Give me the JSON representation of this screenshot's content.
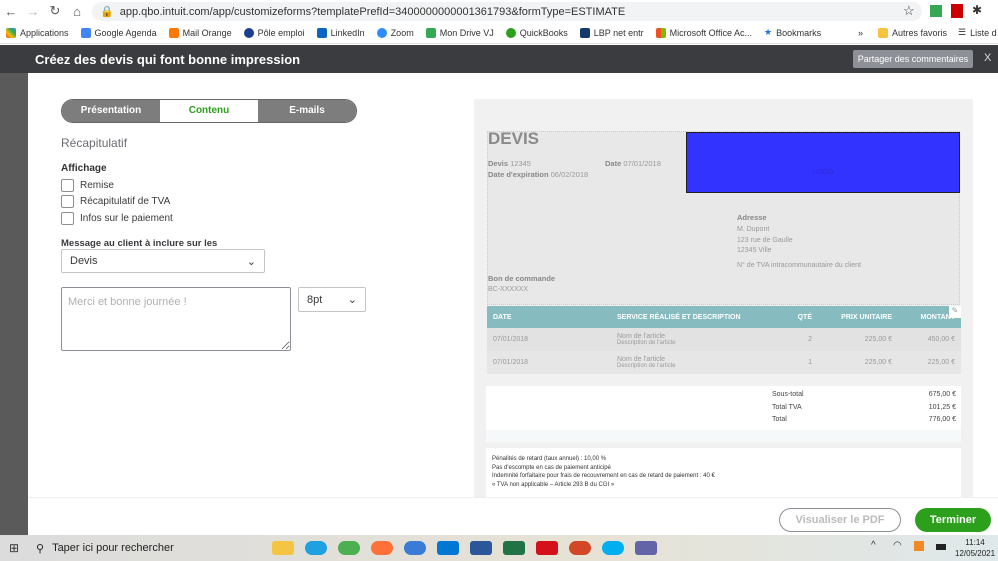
{
  "browser": {
    "url": "app.qbo.intuit.com/app/customizeforms?templatePrefId=3400000000001361793&formType=ESTIMATE",
    "bookmarks": [
      "Applications",
      "Google Agenda",
      "Mail Orange",
      "Pôle emploi",
      "LinkedIn",
      "Zoom",
      "Mon Drive VJ",
      "QuickBooks",
      "LBP net entr",
      "Microsoft Office Ac...",
      "Bookmarks"
    ],
    "overflow": "»",
    "other_bookmarks": "Autres favoris",
    "reading_list": "Liste d"
  },
  "header": {
    "title": "Créez des devis qui font bonne impression",
    "share_label": "Partager des commentaires",
    "close": "X"
  },
  "tabs": [
    {
      "label": "Présentation"
    },
    {
      "label": "Contenu"
    },
    {
      "label": "E-mails"
    }
  ],
  "panel": {
    "section": "Récapitulatif",
    "display_label": "Affichage",
    "checkboxes": [
      {
        "label": "Remise",
        "checked": false
      },
      {
        "label": "Récapitulatif de TVA",
        "checked": false
      },
      {
        "label": "Infos sur le paiement",
        "checked": false
      }
    ],
    "message_label": "Message au client à inclure sur les",
    "message_select": "Devis",
    "message_placeholder": "Merci et bonne journée !",
    "font_size": "8pt"
  },
  "preview": {
    "title": "DEVIS",
    "devis_label": "Devis",
    "devis_no": "12345",
    "date_label": "Date",
    "date": "07/01/2018",
    "exp_label": "Date d'expiration",
    "exp_date": "06/02/2018",
    "logo_text": "LOGO",
    "address_label": "Adresse",
    "address": [
      "M. Dupont",
      "123 rue de Gaulle",
      "12345 Ville"
    ],
    "vat_client": "N° de TVA intracommunautaire du client",
    "po_label": "Bon de commande",
    "po": "BC-XXXXXX",
    "columns": [
      "DATE",
      "SERVICE RÉALISÉ ET DESCRIPTION",
      "QTÉ",
      "PRIX UNITAIRE",
      "MONTANT"
    ],
    "rows": [
      {
        "date": "07/01/2018",
        "name": "Nom de l'article",
        "desc": "Description de l'article",
        "qty": "2",
        "price": "225,00 €",
        "amount": "450,00 €"
      },
      {
        "date": "07/01/2018",
        "name": "Nom de l'article",
        "desc": "Description de l'article",
        "qty": "1",
        "price": "225,00 €",
        "amount": "225,00 €"
      }
    ],
    "totals": [
      {
        "label": "Sous-total",
        "value": "675,00 €"
      },
      {
        "label": "Total TVA",
        "value": "101,25 €"
      },
      {
        "label": "Total",
        "value": "776,00 €"
      }
    ],
    "notes": [
      "Pénalités de retard (taux annuel) : 10,00 %",
      "Pas d'escompte en cas de paiement anticipé",
      "Indemnité forfaitaire pour frais de recouvrement en cas de retard de paiement : 40 €",
      "« TVA non applicable – Article 293 B du CGI »"
    ],
    "accent": "#86bcc0",
    "logo_color": "#3333ff"
  },
  "footer": {
    "pdf_label": "Visualiser le PDF",
    "done_label": "Terminer"
  },
  "taskbar": {
    "search_placeholder": "Taper ici pour rechercher",
    "time": "11:14",
    "date": "12/05/2021"
  }
}
